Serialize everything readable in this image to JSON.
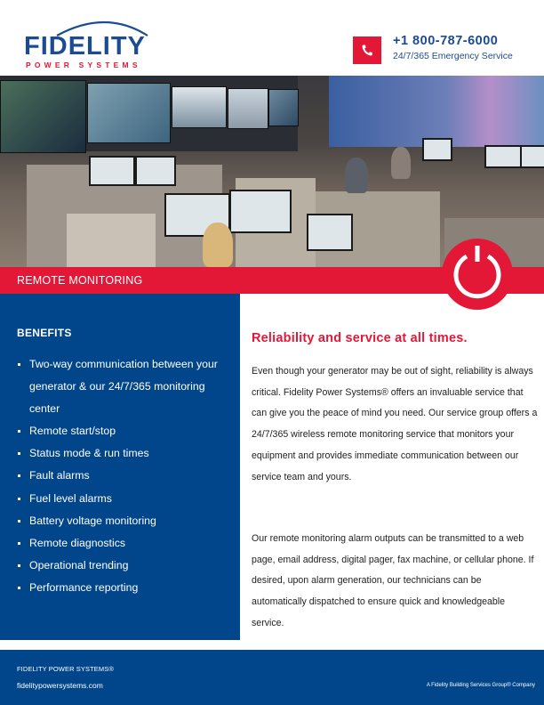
{
  "brand": {
    "name": "FIDELITY",
    "tagline": "POWER SYSTEMS",
    "primary_color": "#1c4b95",
    "accent_color": "#e31837",
    "panel_color": "#01468b"
  },
  "contact": {
    "icon": "phone-icon",
    "phone": "+1 800-787-6000",
    "service": "24/7/365 Emergency Service"
  },
  "hero": {
    "image": "monitoring-center-photo",
    "badge_icon": "power-icon"
  },
  "banner": {
    "title": "REMOTE MONITORING"
  },
  "benefits": {
    "title": "BENEFITS",
    "items": [
      "Two-way communication between your generator & our 24/7/365 monitoring center",
      "Remote start/stop",
      "Status mode &  run times",
      "Fault alarms",
      "Fuel level alarms",
      "Battery voltage monitoring",
      "Remote diagnostics",
      "Operational trending",
      "Performance reporting"
    ]
  },
  "main": {
    "headline": "Reliability and service at all times.",
    "paragraphs": [
      "Even though your generator may be out of sight, reliability is always critical. Fidelity Power Systems® offers an invaluable service that can give you the peace of mind you need. Our service group offers a 24/7/365 wireless remote monitoring  service that monitors your equipment and provides immediate communication between our service team and yours.",
      "Our remote monitoring  alarm outputs can be transmitted to a web page, email address, digital pager, fax machine, or cellular phone. If desired, upon alarm generation, our technicians can be automatically dispatched to ensure quick and knowledgeable service."
    ]
  },
  "footer": {
    "company": "FIDELITY POWER SYSTEMS®",
    "url": "fidelitypowersystems.com",
    "parent": "A Fidelity Building Services Group® Company"
  }
}
